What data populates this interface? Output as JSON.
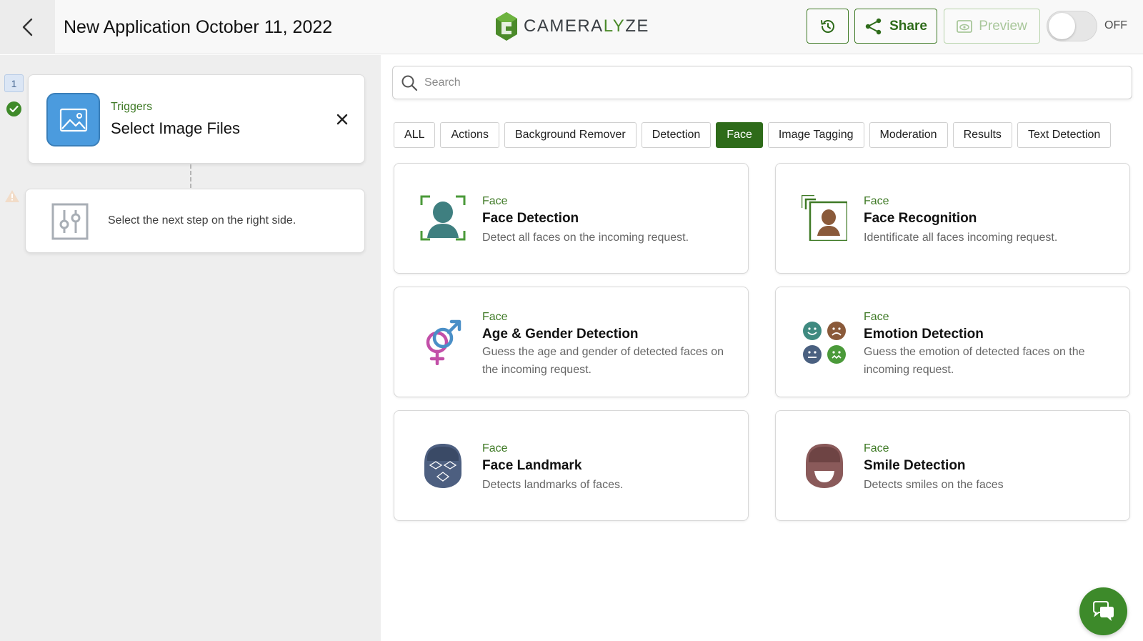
{
  "header": {
    "app_title": "New Application October 11, 2022",
    "logo": {
      "text_main": "CAMERA",
      "text_accent": "LY",
      "text_end": "ZE"
    },
    "share_label": "Share",
    "preview_label": "Preview",
    "toggle_label": "OFF",
    "toggle_on": false
  },
  "flow": {
    "step_number": "1",
    "trigger": {
      "category": "Triggers",
      "title": "Select Image Files"
    },
    "next_step_text": "Select the next step on the right side."
  },
  "search": {
    "placeholder": "Search",
    "value": ""
  },
  "filters": [
    "ALL",
    "Actions",
    "Background Remover",
    "Detection",
    "Face",
    "Image Tagging",
    "Moderation",
    "Results",
    "Text Detection"
  ],
  "active_filter": "Face",
  "cards": [
    {
      "category": "Face",
      "title": "Face Detection",
      "description": "Detect all faces on the incoming request.",
      "icon": "face-detection-icon"
    },
    {
      "category": "Face",
      "title": "Face Recognition",
      "description": "Identificate all faces incoming request.",
      "icon": "face-recognition-icon"
    },
    {
      "category": "Face",
      "title": "Age & Gender Detection",
      "description": "Guess the age and gender of detected faces on the incoming request.",
      "icon": "gender-icon"
    },
    {
      "category": "Face",
      "title": "Emotion Detection",
      "description": "Guess the emotion of detected faces on the incoming request.",
      "icon": "emotion-icon"
    },
    {
      "category": "Face",
      "title": "Face Landmark",
      "description": "Detects landmarks of faces.",
      "icon": "face-landmark-icon"
    },
    {
      "category": "Face",
      "title": "Smile Detection",
      "description": "Detects smiles on the faces",
      "icon": "smile-icon"
    }
  ],
  "colors": {
    "brand_green": "#3f7a26",
    "active_chip": "#2e6b1a",
    "trigger_blue": "#4b9bde",
    "chat_green": "#3d8a2a"
  }
}
